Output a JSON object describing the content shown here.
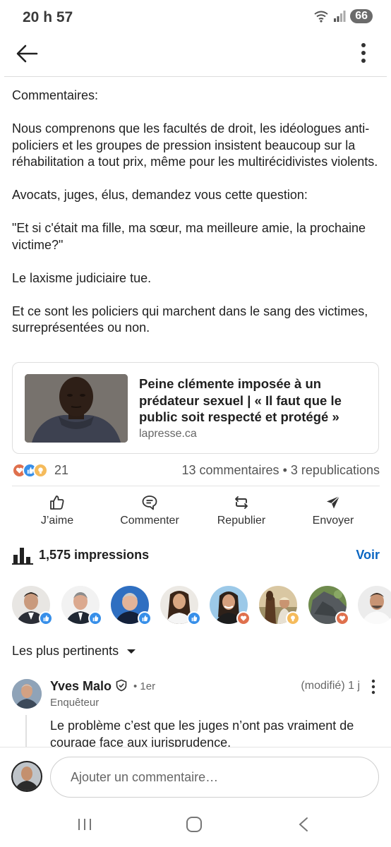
{
  "status_bar": {
    "time": "20 h 57",
    "battery": "66"
  },
  "post": {
    "paragraphs": [
      "Commentaires:",
      "Nous comprenons que les facultés de droit, les idéologues anti-policiers et les groupes de pression insistent beaucoup sur la réhabilitation a tout prix, même pour les multirécidivistes violents.",
      "Avocats, juges, élus, demandez vous cette question:",
      "\"Et si c'était ma fille, ma sœur, ma meilleure amie, la prochaine victime?\"",
      "Le laxisme judiciaire tue.",
      "Et ce sont les policiers qui marchent dans le sang des victimes, surreprésentées ou non."
    ]
  },
  "link_card": {
    "title": "Peine clémente imposée à un prédateur sexuel | « Il faut que le public soit respecté et protégé »",
    "source": "lapresse.ca"
  },
  "stats": {
    "reactions_count": "21",
    "comments": "13 commentaires",
    "separator": "•",
    "reposts": "3 republications"
  },
  "actions": {
    "like": "J’aime",
    "comment": "Commenter",
    "repost": "Republier",
    "send": "Envoyer"
  },
  "impressions": {
    "label": "1,575 impressions",
    "view_label": "Voir"
  },
  "sort": {
    "label": "Les plus pertinents"
  },
  "comment": {
    "author": "Yves Malo",
    "degree": "• 1er",
    "meta": "(modifié) 1 j",
    "headline": "Enquêteur",
    "text": "Le problème c’est que les juges n’ont pas vraiment de courage face aux jurisprudence."
  },
  "composer": {
    "placeholder": "Ajouter un commentaire…"
  },
  "colors": {
    "accent": "#0a66c2",
    "like": "#378fe9",
    "support": "#c37d16",
    "love": "#df704d"
  }
}
